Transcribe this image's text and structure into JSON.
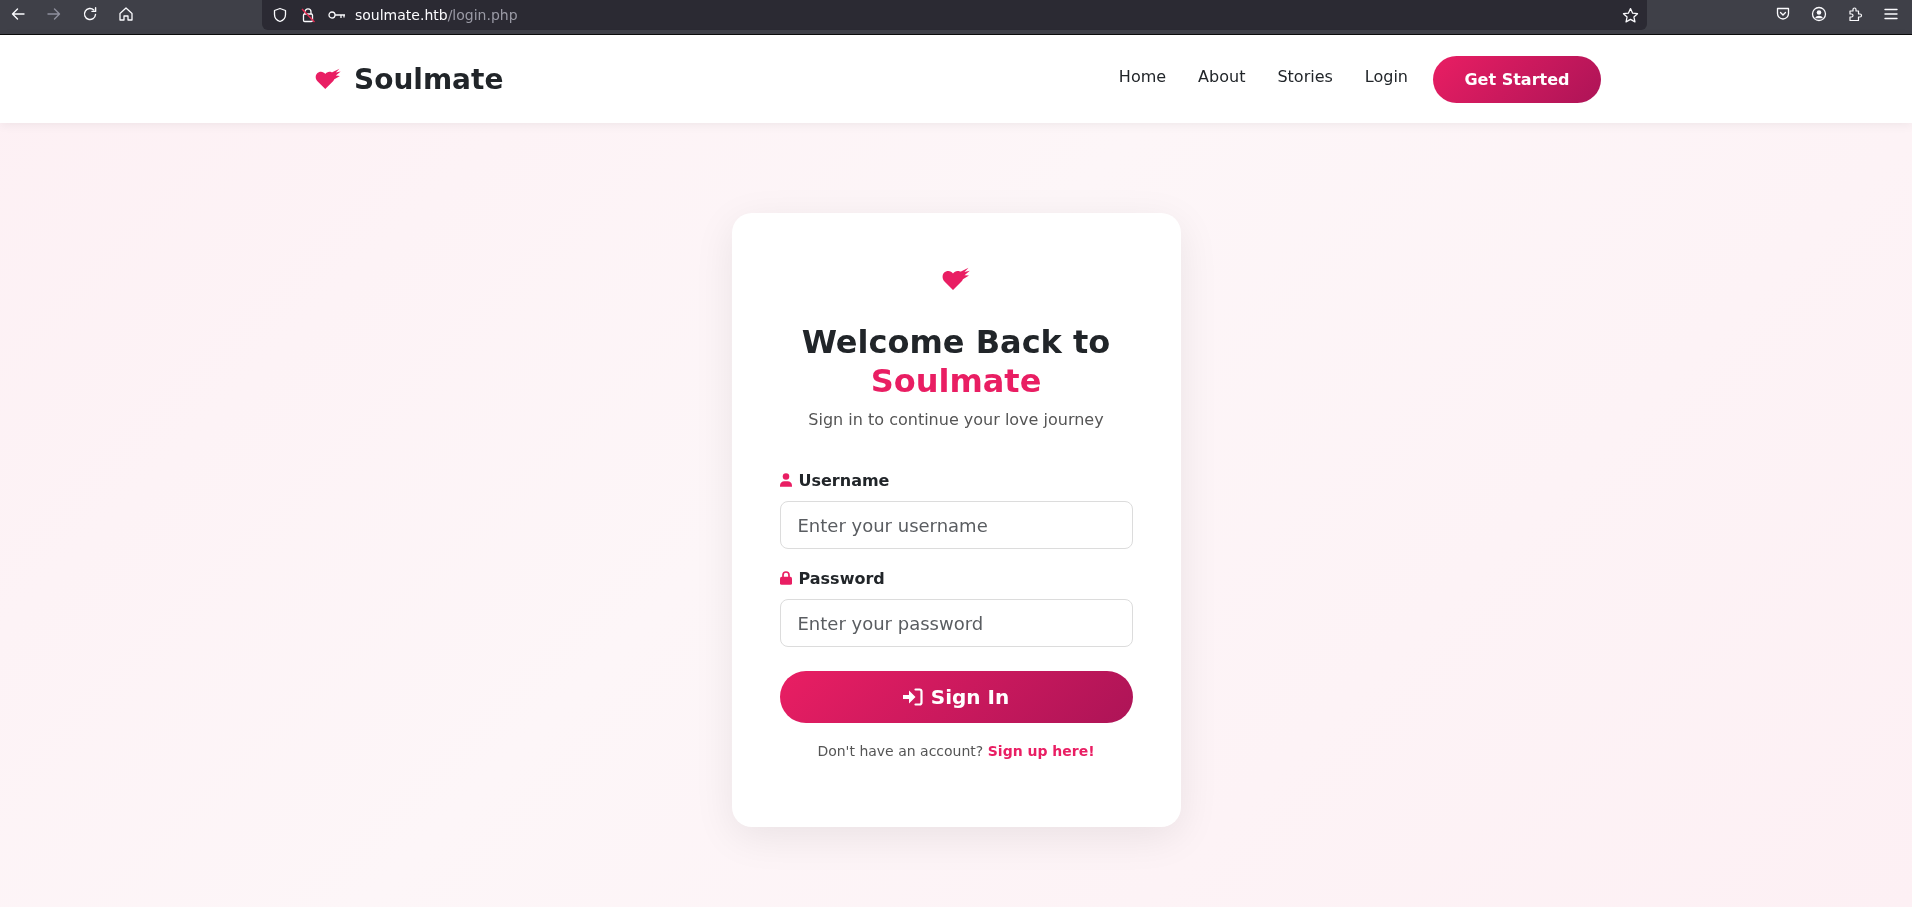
{
  "browser": {
    "url_host": "soulmate.htb",
    "url_path": "/login.php"
  },
  "header": {
    "brand": "Soulmate",
    "nav": [
      {
        "label": "Home"
      },
      {
        "label": "About"
      },
      {
        "label": "Stories"
      },
      {
        "label": "Login"
      }
    ],
    "cta": "Get Started"
  },
  "login_card": {
    "title": "Welcome Back to",
    "title_highlight": "Soulmate",
    "subtitle": "Sign in to continue your love journey",
    "fields": [
      {
        "kind": "text",
        "label": "Username",
        "placeholder": "Enter your username"
      },
      {
        "kind": "password",
        "label": "Password",
        "placeholder": "Enter your password"
      }
    ],
    "submit": "Sign In",
    "footer_text": "Don't have an account?",
    "footer_link": "Sign up here!"
  }
}
